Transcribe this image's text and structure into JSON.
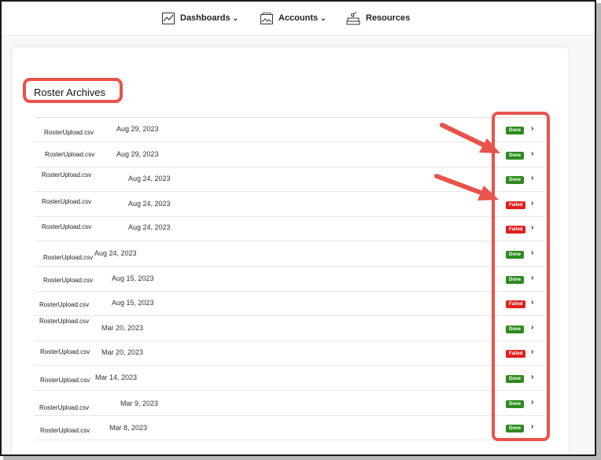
{
  "nav": {
    "dashboards": {
      "label": "Dashboards",
      "icon": "line-chart-icon"
    },
    "accounts": {
      "label": "Accounts",
      "icon": "image-icon"
    },
    "resources": {
      "label": "Resources",
      "icon": "book-stack-icon"
    }
  },
  "page": {
    "title": "Roster Archives"
  },
  "rows": [
    {
      "file": "RosterUpload.csv",
      "date": "Aug 29, 2023",
      "status": "Done"
    },
    {
      "file": "RosterUpload.csv",
      "date": "Aug 29, 2023",
      "status": "Done"
    },
    {
      "file": "RosterUpload.csv",
      "date": "Aug 24, 2023",
      "status": "Done"
    },
    {
      "file": "RosterUpload.csv",
      "date": "Aug 24, 2023",
      "status": "Failed"
    },
    {
      "file": "RosterUpload.csv",
      "date": "Aug 24, 2023",
      "status": "Failed"
    },
    {
      "file": "RosterUpload.csv",
      "date": "Aug 24, 2023",
      "status": "Done"
    },
    {
      "file": "RosterUpload.csv",
      "date": "Aug 15, 2023",
      "status": "Done"
    },
    {
      "file": "RosterUpload.csv",
      "date": "Aug 15, 2023",
      "status": "Failed"
    },
    {
      "file": "RosterUpload.csv",
      "date": "Mar 20, 2023",
      "status": "Done"
    },
    {
      "file": "RosterUpload.csv",
      "date": "Mar 20, 2023",
      "status": "Failed"
    },
    {
      "file": "RosterUpload.csv",
      "date": "Mar 14, 2023",
      "status": "Done"
    },
    {
      "file": "RosterUpload.csv",
      "date": "Mar 9, 2023",
      "status": "Done"
    },
    {
      "file": "RosterUpload.csv",
      "date": "Mar 8, 2023",
      "status": "Done"
    }
  ],
  "colors": {
    "done": "#2e8a1e",
    "failed": "#e0201e",
    "annotation": "#e8534b"
  }
}
